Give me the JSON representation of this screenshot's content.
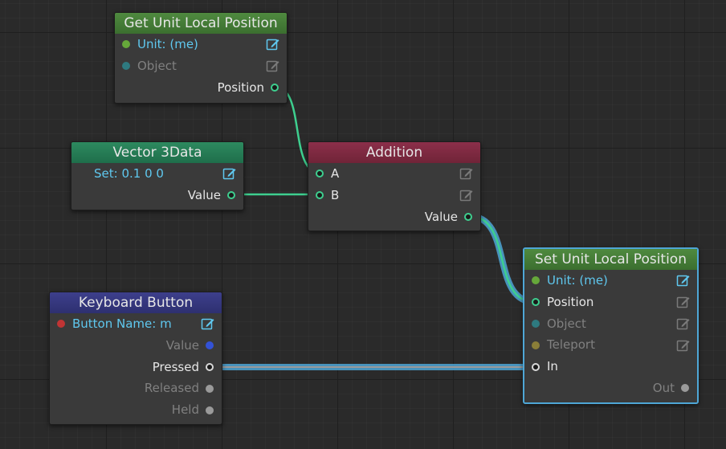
{
  "nodes": {
    "get_pos": {
      "title": "Get Unit Local Position",
      "unit": "Unit: (me)",
      "object": "Object",
      "position": "Position"
    },
    "vector": {
      "title": "Vector 3Data",
      "set": "Set: 0.1 0 0",
      "value": "Value"
    },
    "addition": {
      "title": "Addition",
      "a": "A",
      "b": "B",
      "value": "Value"
    },
    "set_pos": {
      "title": "Set Unit Local Position",
      "unit": "Unit: (me)",
      "position": "Position",
      "object": "Object",
      "teleport": "Teleport",
      "in": "In",
      "out": "Out"
    },
    "keyboard": {
      "title": "Keyboard Button",
      "button_name": "Button Name: m",
      "value": "Value",
      "pressed": "Pressed",
      "released": "Released",
      "held": "Held"
    }
  },
  "colors": {
    "data_wire": "#3ecf8f",
    "exec_wire": "#4ea6d6",
    "selected_wire": "#4ea6d6",
    "header_green": "#4f8a3f",
    "header_teal": "#2d8a5f",
    "header_red": "#8c2f4a",
    "header_blue": "#3d3f8c"
  },
  "icons": {
    "edit": "edit-icon",
    "port": "port-icon"
  }
}
